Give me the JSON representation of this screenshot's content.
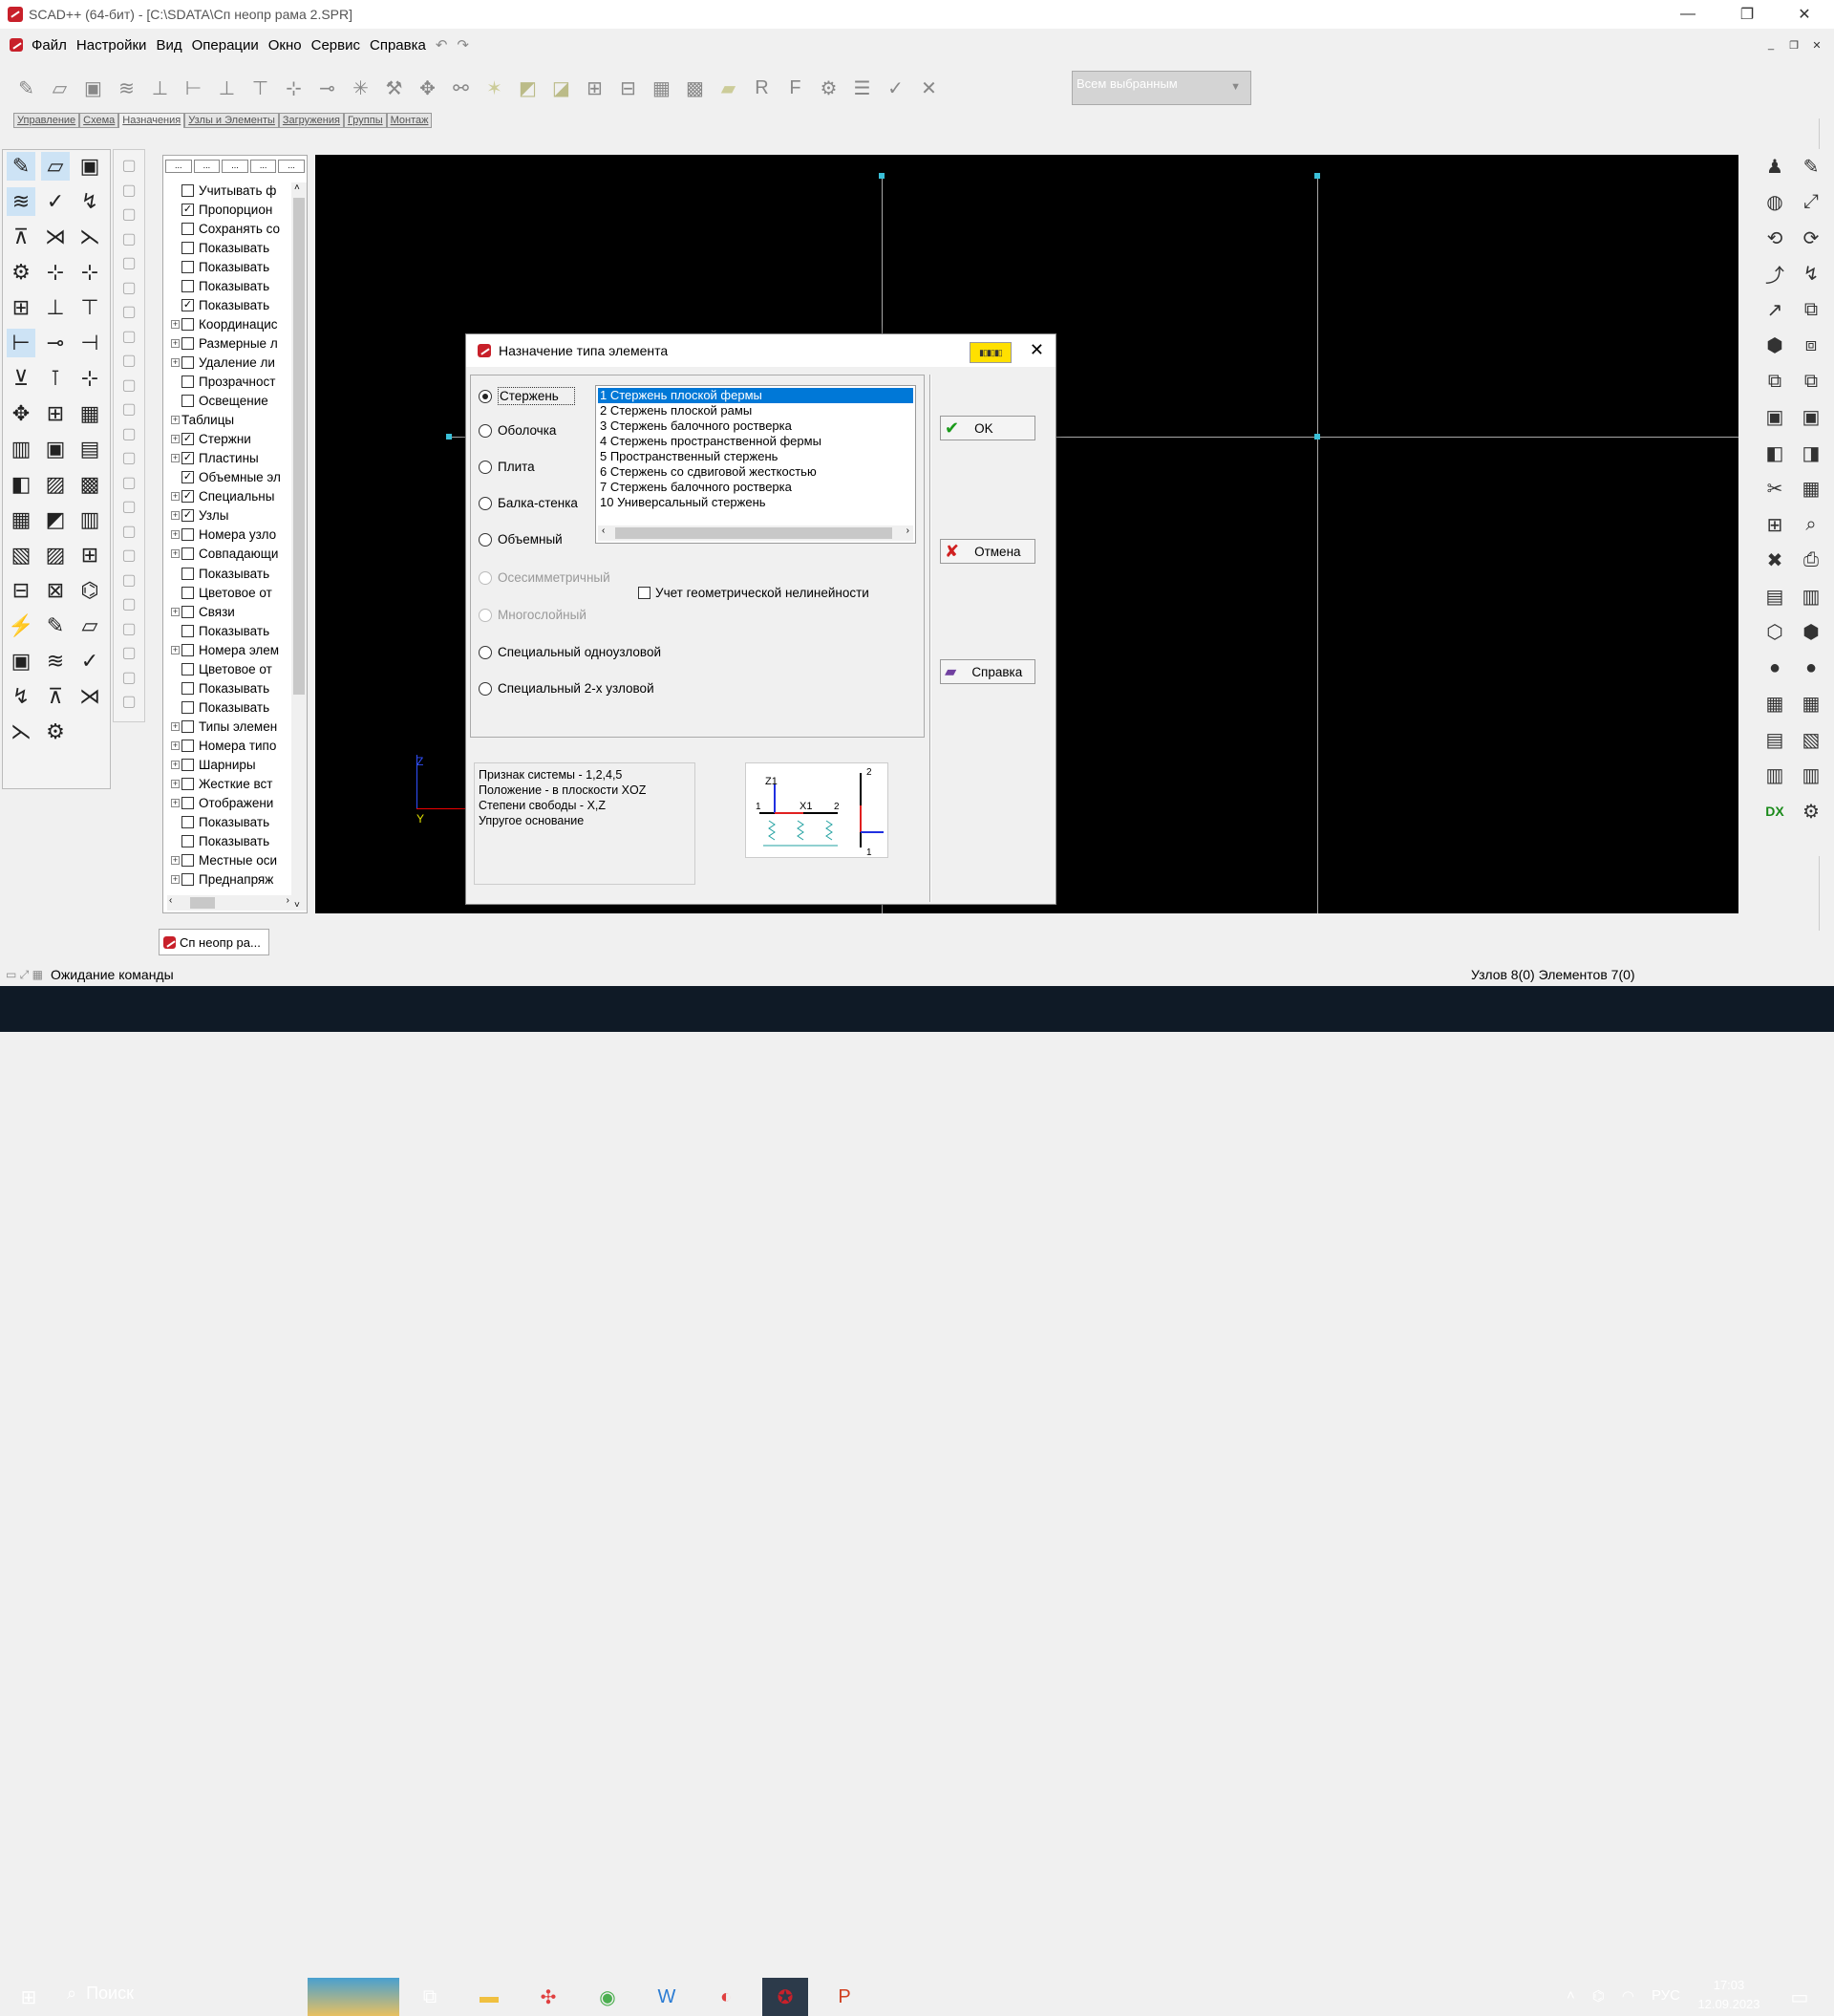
{
  "window": {
    "title": "SCAD++ (64-бит) - [C:\\SDATA\\Сп неопр рама 2.SPR]"
  },
  "menu": [
    "Файл",
    "Настройки",
    "Вид",
    "Операции",
    "Окно",
    "Сервис",
    "Справка"
  ],
  "selection_combo": "Всем выбранным",
  "tabs": [
    "Управление",
    "Схема",
    "Назначения",
    "Узлы и Элементы",
    "Загружения",
    "Группы",
    "Монтаж"
  ],
  "tree": [
    {
      "label": "Учитывать ф",
      "checked": false,
      "exp": ""
    },
    {
      "label": "Пропорцион",
      "checked": true,
      "exp": ""
    },
    {
      "label": "Сохранять со",
      "checked": false,
      "exp": ""
    },
    {
      "label": "Показывать",
      "checked": false,
      "exp": ""
    },
    {
      "label": "Показывать",
      "checked": false,
      "exp": ""
    },
    {
      "label": "Показывать",
      "checked": false,
      "exp": ""
    },
    {
      "label": "Показывать",
      "checked": true,
      "exp": ""
    },
    {
      "label": "Координацис",
      "checked": false,
      "exp": "+"
    },
    {
      "label": "Размерные л",
      "checked": false,
      "exp": "+"
    },
    {
      "label": "Удаление ли",
      "checked": false,
      "exp": "+"
    },
    {
      "label": "Прозрачност",
      "checked": false,
      "exp": ""
    },
    {
      "label": "Освещение",
      "checked": false,
      "exp": ""
    },
    {
      "label": "Таблицы",
      "checked": null,
      "exp": "+"
    },
    {
      "label": "Стержни",
      "checked": true,
      "exp": "+"
    },
    {
      "label": "Пластины",
      "checked": true,
      "exp": "+"
    },
    {
      "label": "Объемные эл",
      "checked": true,
      "exp": ""
    },
    {
      "label": "Специальны",
      "checked": true,
      "exp": "+"
    },
    {
      "label": "Узлы",
      "checked": true,
      "exp": "+"
    },
    {
      "label": "Номера узло",
      "checked": false,
      "exp": "+"
    },
    {
      "label": "Совпадающи",
      "checked": false,
      "exp": "+"
    },
    {
      "label": "Показывать",
      "checked": false,
      "exp": ""
    },
    {
      "label": "Цветовое от",
      "checked": false,
      "exp": ""
    },
    {
      "label": "Связи",
      "checked": false,
      "exp": "+"
    },
    {
      "label": "Показывать",
      "checked": false,
      "exp": ""
    },
    {
      "label": "Номера элем",
      "checked": false,
      "exp": "+"
    },
    {
      "label": "Цветовое от",
      "checked": false,
      "exp": ""
    },
    {
      "label": "Показывать",
      "checked": false,
      "exp": ""
    },
    {
      "label": "Показывать",
      "checked": false,
      "exp": ""
    },
    {
      "label": "Типы элемен",
      "checked": false,
      "exp": "+"
    },
    {
      "label": "Номера типо",
      "checked": false,
      "exp": "+"
    },
    {
      "label": "Шарниры",
      "checked": false,
      "exp": "+"
    },
    {
      "label": "Жесткие вст",
      "checked": false,
      "exp": "+"
    },
    {
      "label": "Отображени",
      "checked": false,
      "exp": "+"
    },
    {
      "label": "Показывать",
      "checked": false,
      "exp": ""
    },
    {
      "label": "Показывать",
      "checked": false,
      "exp": ""
    },
    {
      "label": "Местные оси",
      "checked": false,
      "exp": "+"
    },
    {
      "label": "Преднапряж",
      "checked": false,
      "exp": "+"
    }
  ],
  "doc_tab": "Сп неопр ра...",
  "axes": {
    "z": "Z",
    "y": "Y"
  },
  "status": {
    "left": "Ожидание команды",
    "right": "Узлов 8(0) Элементов 7(0)"
  },
  "taskbar": {
    "search": "Поиск",
    "lang": "РУС",
    "time": "17:03",
    "date": "12.09.2023"
  },
  "dialog": {
    "title": "Назначение типа элемента",
    "radios": [
      {
        "label": "Стержень",
        "on": true,
        "disabled": false
      },
      {
        "label": "Оболочка",
        "on": false,
        "disabled": false
      },
      {
        "label": "Плита",
        "on": false,
        "disabled": false
      },
      {
        "label": "Балка-стенка",
        "on": false,
        "disabled": false
      },
      {
        "label": "Объемный",
        "on": false,
        "disabled": false
      },
      {
        "label": "Осесимметричный",
        "on": false,
        "disabled": true
      },
      {
        "label": "Многослойный",
        "on": false,
        "disabled": true
      },
      {
        "label": "Специальный одноузловой",
        "on": false,
        "disabled": false
      },
      {
        "label": "Специальный 2-х узловой",
        "on": false,
        "disabled": false
      }
    ],
    "types": [
      "1 Стержень плоской фермы",
      "2 Стержень плоской рамы",
      "3 Стержень балочного ростверка",
      "4 Стержень пространственной фермы",
      "5 Пространственный стержень",
      "6 Стержень со сдвиговой жесткостью",
      "7 Стержень балочного ростверка",
      "10 Универсальный стержень"
    ],
    "selected_type": 0,
    "nonlinear_label": "Учет геометрической нелинейности",
    "info": [
      "Признак системы - 1,2,4,5",
      "Положение - в плоскости XOZ",
      "Степени свободы - X,Z",
      "Упругое основание"
    ],
    "ok": "OK",
    "cancel": "Отмена",
    "help": "Справка"
  },
  "colors": {
    "canvas": "#000000",
    "grid": "#a8a8a8",
    "node": "#3ac0d8",
    "selection": "#0078d7"
  }
}
